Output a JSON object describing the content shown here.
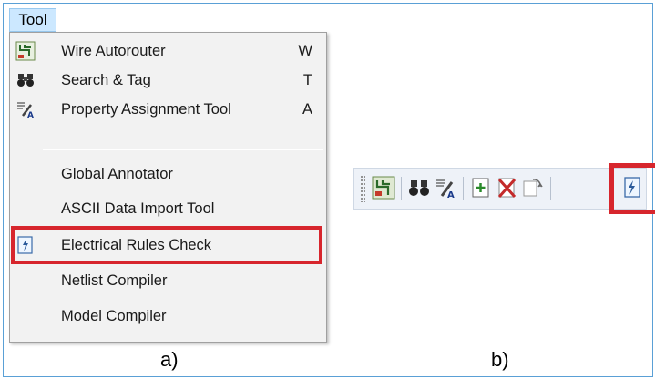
{
  "menu": {
    "title": "Tool",
    "items": [
      {
        "label": "Wire Autorouter",
        "shortcut": "W",
        "icon": "wire-autorouter-icon"
      },
      {
        "label": "Search & Tag",
        "shortcut": "T",
        "icon": "binoculars-icon"
      },
      {
        "label": "Property Assignment Tool",
        "shortcut": "A",
        "icon": "property-assignment-icon"
      },
      {
        "label": "Global Annotator",
        "shortcut": ""
      },
      {
        "label": "ASCII Data Import Tool",
        "shortcut": ""
      },
      {
        "label": "Electrical Rules Check",
        "shortcut": "",
        "icon": "electrical-rules-check-icon"
      },
      {
        "label": "Netlist Compiler",
        "shortcut": ""
      },
      {
        "label": "Model Compiler",
        "shortcut": ""
      }
    ]
  },
  "toolbar": {
    "icons": [
      "wire-autorouter-icon",
      "binoculars-icon",
      "property-assignment-icon",
      "new-document-icon",
      "delete-icon",
      "refresh-icon",
      "electrical-rules-check-icon"
    ]
  },
  "captions": {
    "a": "a)",
    "b": "b)"
  },
  "colors": {
    "highlight": "#d7262d",
    "menu_hover": "#cce8ff"
  }
}
